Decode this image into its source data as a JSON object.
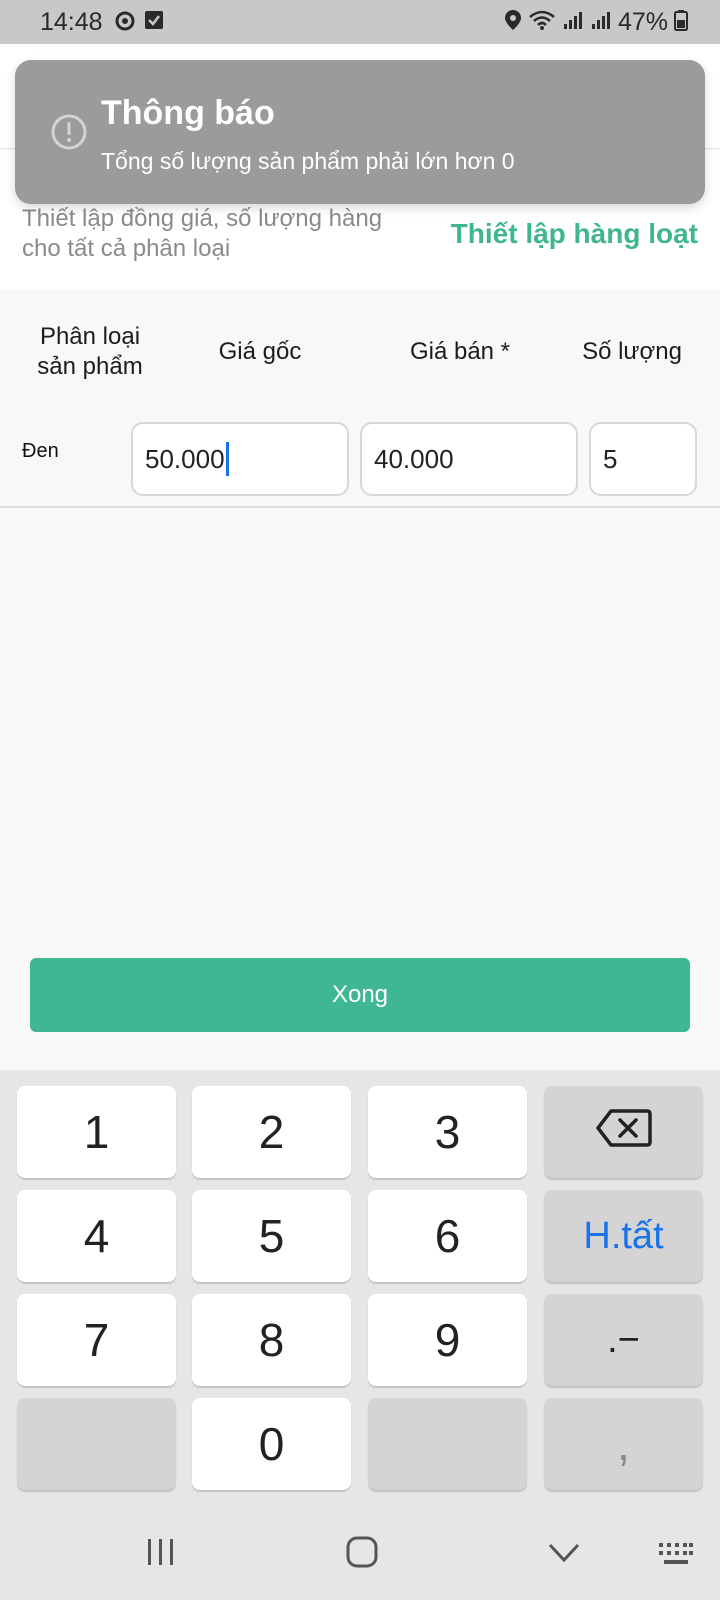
{
  "status_bar": {
    "time": "14:48",
    "battery": "47%",
    "icons": [
      "sync-icon",
      "checkbox-icon",
      "location-icon",
      "wifi-icon",
      "signal-icon",
      "signal-icon",
      "battery-icon"
    ]
  },
  "bulk_setup": {
    "description": "Thiết lập đồng giá, số lượng hàng cho tất cả phân loại",
    "action_label": "Thiết lập hàng loạt"
  },
  "table": {
    "headers": [
      "Phân loại sản phẩm",
      "Giá gốc",
      "Giá bán *",
      "Số lượng"
    ],
    "rows": [
      {
        "variant": "Đen",
        "original_price": "50.000",
        "sale_price": "40.000",
        "quantity": "5"
      }
    ]
  },
  "done_label": "Xong",
  "keyboard": {
    "keys": [
      "1",
      "2",
      "3",
      "4",
      "5",
      "6",
      "7",
      "8",
      "9",
      "0"
    ],
    "done_key": "H.tất",
    "dot_minus": ".−",
    "comma": ","
  },
  "toast": {
    "title": "Thông báo",
    "message": "Tổng số lượng sản phẩm phải lớn hơn 0"
  },
  "colors": {
    "accent": "#40b793",
    "link": "#3fb68f",
    "key_blue": "#1a73e8",
    "toast_bg": "#9b9b9b"
  }
}
